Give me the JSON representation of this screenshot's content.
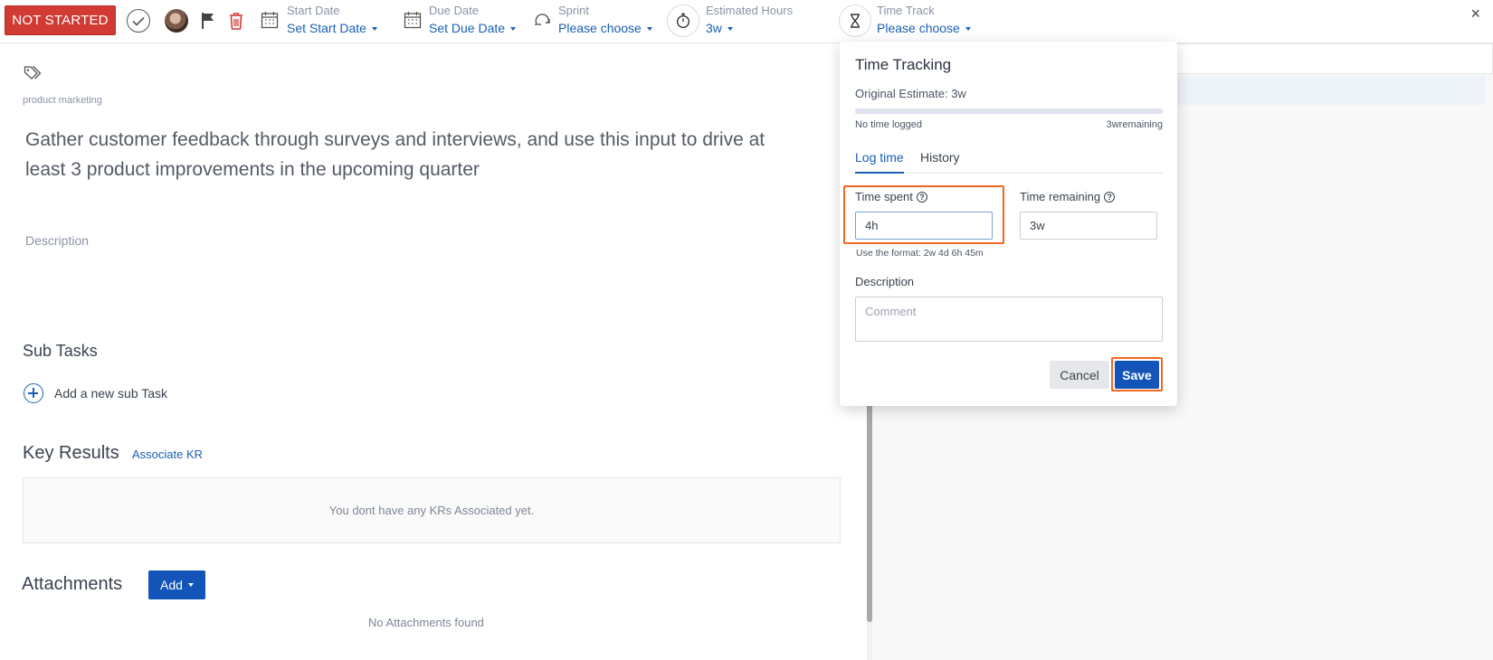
{
  "toolbar": {
    "status_label": "NOT STARTED",
    "start_date": {
      "label": "Start Date",
      "value": "Set Start Date"
    },
    "due_date": {
      "label": "Due Date",
      "value": "Set Due Date"
    },
    "sprint": {
      "label": "Sprint",
      "value": "Please choose"
    },
    "estimated_hours": {
      "label": "Estimated Hours",
      "value": "3w"
    },
    "time_track": {
      "label": "Time Track",
      "value": "Please choose"
    },
    "close_glyph": "×"
  },
  "task": {
    "tag": "product marketing",
    "title": "Gather customer feedback through surveys and interviews, and use this input to drive at least 3 product improvements in the upcoming quarter",
    "description_placeholder": "Description"
  },
  "subtasks": {
    "heading": "Sub Tasks",
    "add_label": "Add a new sub Task"
  },
  "key_results": {
    "heading": "Key Results",
    "associate_label": "Associate KR",
    "empty_text": "You dont have any KRs Associated yet."
  },
  "attachments": {
    "heading": "Attachments",
    "add_label": "Add",
    "empty_text": "No Attachments found"
  },
  "time_tracking": {
    "title": "Time Tracking",
    "original_estimate": "Original Estimate: 3w",
    "progress_fraction": 0,
    "logged_text": "No time logged",
    "remaining_text": "3wremaining",
    "tabs": [
      {
        "label": "Log time",
        "active": true
      },
      {
        "label": "History",
        "active": false
      }
    ],
    "time_spent": {
      "label": "Time spent",
      "value": "4h"
    },
    "time_remaining": {
      "label": "Time remaining",
      "value": "3w"
    },
    "help_glyph": "?",
    "format_hint": "Use the format: 2w 4d 6h 45m",
    "description_label": "Description",
    "comment_placeholder": "Comment",
    "cancel_label": "Cancel",
    "save_label": "Save"
  },
  "colors": {
    "accent": "#1a5fb4",
    "status": "#d13b34",
    "highlight": "#f26722",
    "primary_button": "#1254b8"
  }
}
